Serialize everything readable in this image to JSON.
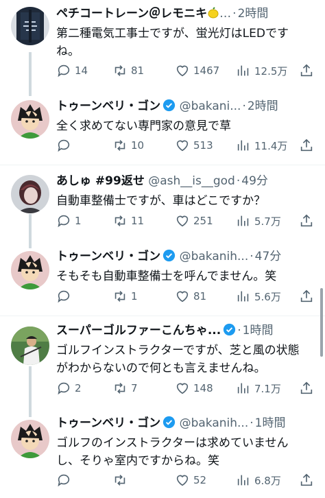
{
  "tweets": [
    {
      "name": "ペチコートレーン＠レモニキ",
      "handle": "…",
      "time": "2時間",
      "text": "第二種電気工事士ですが、蛍光灯はLEDですね。",
      "replies": "14",
      "retweets": "81",
      "likes": "1467",
      "views": "12.5万",
      "avatar_icon": "jacket-photo-avatar"
    },
    {
      "name": "トゥーンベリ・ゴン",
      "handle": "@bakani...",
      "time": "2時間",
      "text": "全く求めてない専門家の意見で草",
      "replies": "",
      "retweets": "10",
      "likes": "513",
      "views": "11.4万",
      "avatar_icon": "anime-boy-avatar"
    },
    {
      "name": "あしゅ #99返せ",
      "handle": "@ash__is__god",
      "time": "49分",
      "text": "自動車整備士ですが、車はどこですか？",
      "replies": "1",
      "retweets": "11",
      "likes": "251",
      "views": "5.7万",
      "avatar_icon": "dark-photo-avatar"
    },
    {
      "name": "トゥーンベリ・ゴン",
      "handle": "@bakanih...",
      "time": "47分",
      "text": "そもそも自動車整備士を呼んでません。笑",
      "replies": "",
      "retweets": "1",
      "likes": "81",
      "views": "5.6万",
      "avatar_icon": "anime-boy-avatar"
    },
    {
      "name": "スーパーゴルファーこんちゃ...",
      "handle": "",
      "time": "1時間",
      "text": "ゴルフインストラクターですが、芝と風の状態がわからないので何とも言えませんね。",
      "replies": "2",
      "retweets": "7",
      "likes": "148",
      "views": "7.1万",
      "avatar_icon": "golfer-photo-avatar"
    },
    {
      "name": "トゥーンベリ・ゴン",
      "handle": "@bakanih...",
      "time": "1時間",
      "text": "ゴルフのインストラクターは求めていませんし、そりゃ室内ですからね。笑",
      "replies": "",
      "retweets": "",
      "likes": "52",
      "views": "6.8万",
      "avatar_icon": "anime-boy-avatar"
    }
  ],
  "colors": {
    "text": "#0f1419",
    "muted": "#536471",
    "verified": "#1d9bf0",
    "thread_line": "#cfd9de",
    "divider": "#eff3f4"
  }
}
